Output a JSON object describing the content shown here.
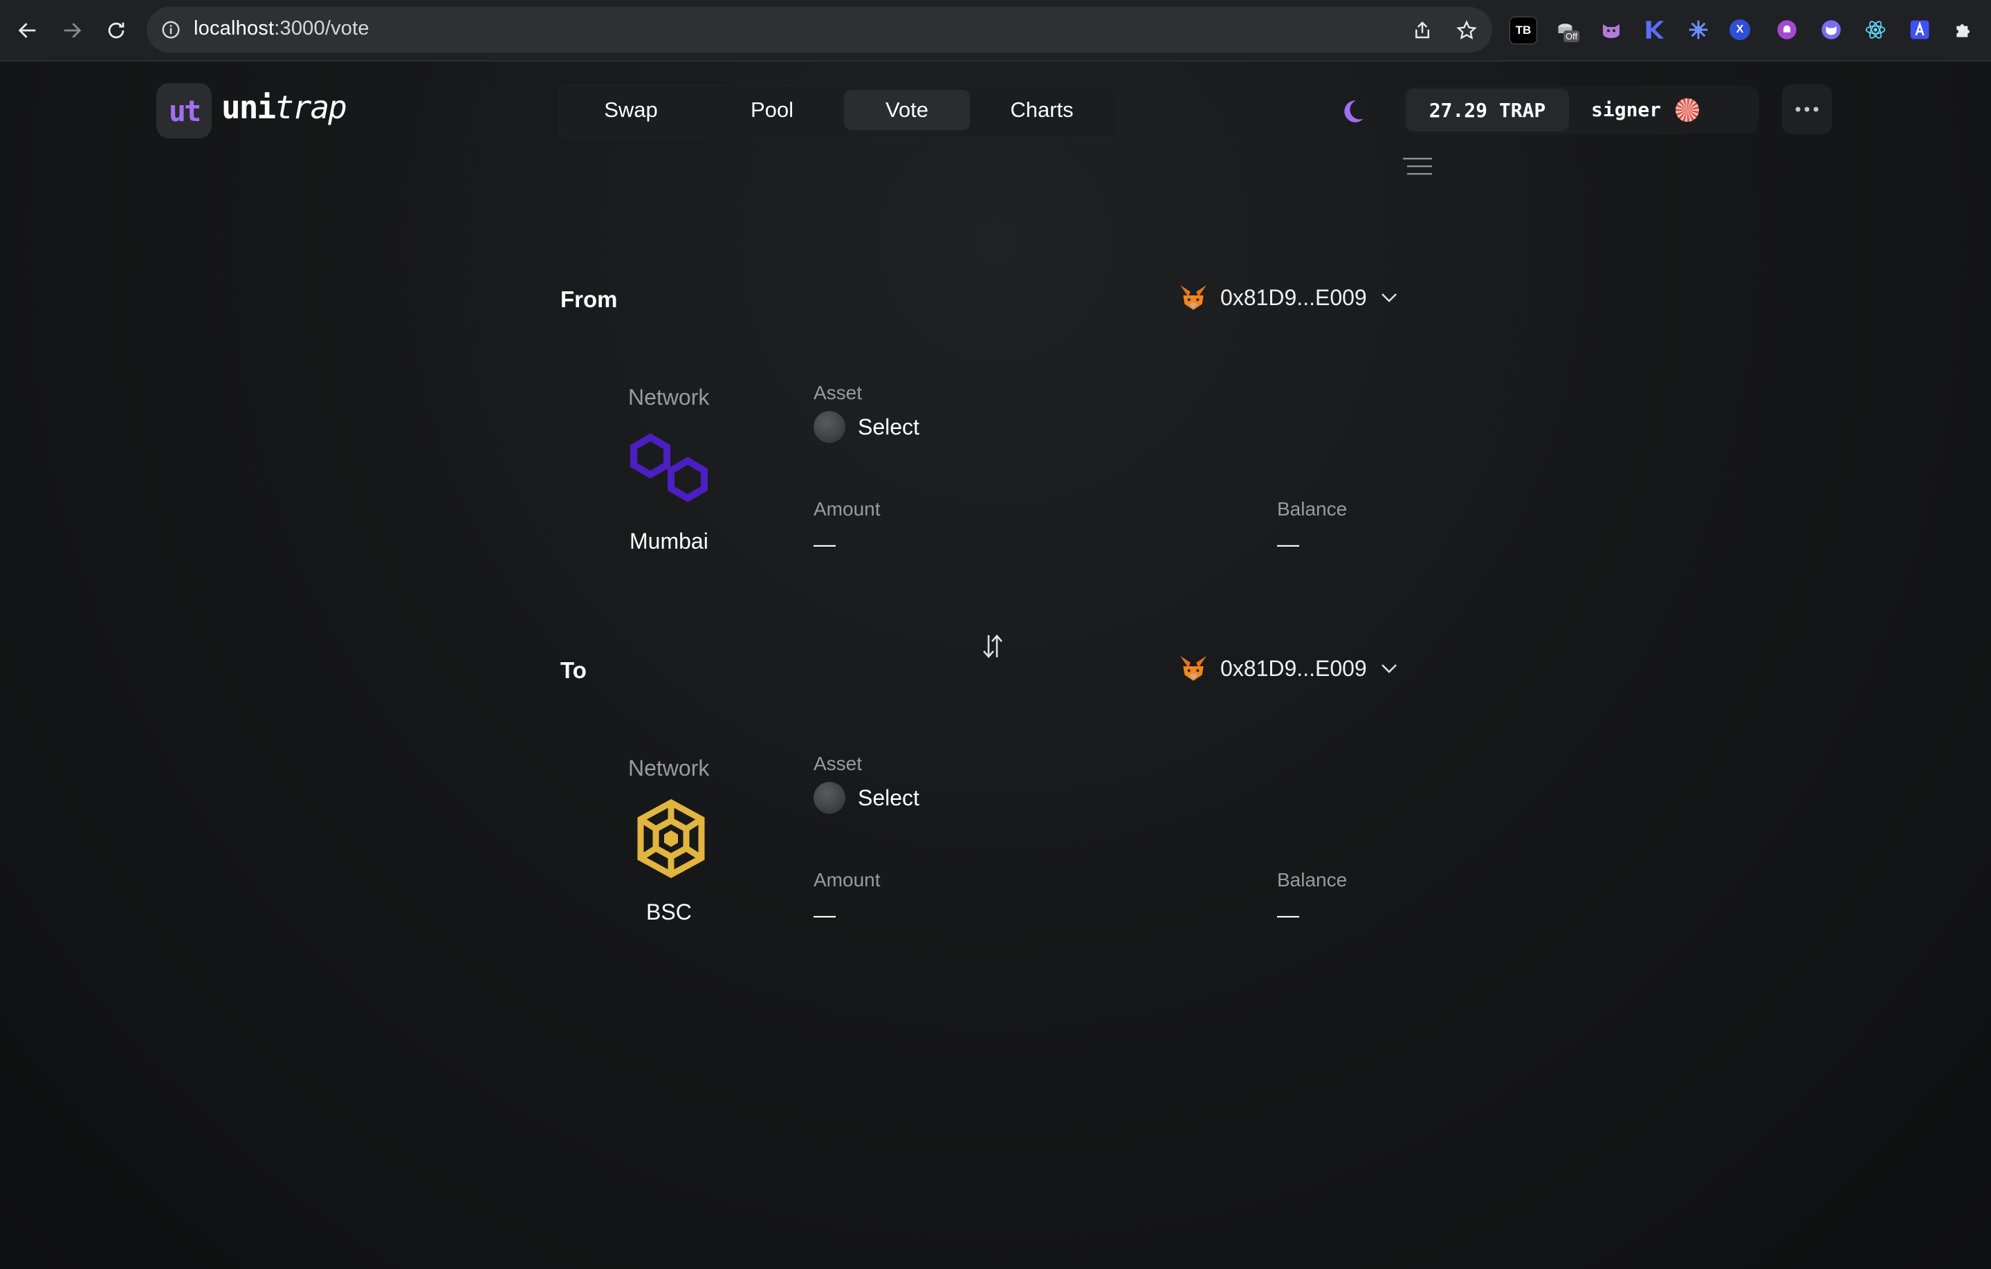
{
  "browser": {
    "url_host": "localhost",
    "url_path": ":3000/vote",
    "extensions": [
      {
        "name": "tb-extension-icon",
        "label": "TB"
      },
      {
        "name": "off-extension-icon",
        "label": "Off"
      },
      {
        "name": "x-extension-icon",
        "label": "X"
      }
    ]
  },
  "app": {
    "logo_badge": "ut",
    "logo_word_a": "uni",
    "logo_word_b": "trap",
    "accent_color": "#a16ff0"
  },
  "nav": {
    "tabs": [
      {
        "label": "Swap"
      },
      {
        "label": "Pool"
      },
      {
        "label": "Vote",
        "active": true
      },
      {
        "label": "Charts"
      }
    ]
  },
  "header": {
    "balance": "27.29 TRAP",
    "account": "signer"
  },
  "bridge": {
    "from": {
      "title": "From",
      "address": "0x81D9...E009",
      "network_label": "Network",
      "network_name": "Mumbai",
      "network_icon": "polygon-icon",
      "asset_label": "Asset",
      "asset_value": "Select",
      "amount_label": "Amount",
      "amount_value": "—",
      "balance_label": "Balance",
      "balance_value": "—"
    },
    "to": {
      "title": "To",
      "address": "0x81D9...E009",
      "network_label": "Network",
      "network_name": "BSC",
      "network_icon": "bnb-icon",
      "asset_label": "Asset",
      "asset_value": "Select",
      "amount_label": "Amount",
      "amount_value": "—",
      "balance_label": "Balance",
      "balance_value": "—"
    }
  }
}
